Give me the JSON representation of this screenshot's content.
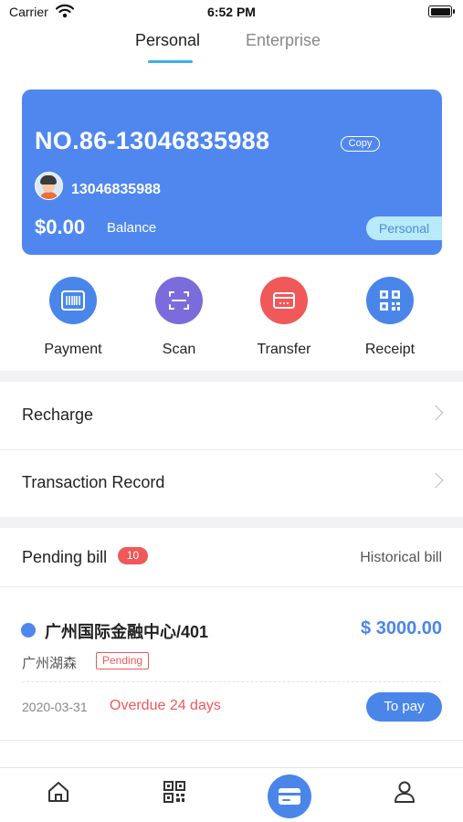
{
  "status_bar": {
    "carrier": "Carrier",
    "time": "6:52 PM"
  },
  "tabs": [
    {
      "label": "Personal",
      "active": true
    },
    {
      "label": "Enterprise",
      "active": false
    }
  ],
  "card": {
    "number": "NO.86-13046835988",
    "copy_label": "Copy",
    "phone": "13046835988",
    "balance_amount": "$0.00",
    "balance_label": "Balance",
    "type_tag": "Personal",
    "color": "#4f87ef"
  },
  "actions": [
    {
      "label": "Payment",
      "icon": "barcode-icon",
      "color": "#4a86ea"
    },
    {
      "label": "Scan",
      "icon": "scan-icon",
      "color": "#7b6cdc"
    },
    {
      "label": "Transfer",
      "icon": "card-icon",
      "color": "#f0585a"
    },
    {
      "label": "Receipt",
      "icon": "qr-code-icon",
      "color": "#4a86ea"
    }
  ],
  "menu": [
    {
      "label": "Recharge"
    },
    {
      "label": "Transaction Record"
    }
  ],
  "bills": {
    "pending_label": "Pending bill",
    "pending_count": "10",
    "historical_label": "Historical bill",
    "items": [
      {
        "title": "广州国际金融中心/401",
        "amount": "$ 3000.00",
        "subtitle": "广州湖森",
        "status": "Pending",
        "date": "2020-03-31",
        "overdue": "Overdue 24 days",
        "action_label": "To pay"
      }
    ]
  },
  "tabbar": [
    {
      "icon": "home-icon"
    },
    {
      "icon": "qr-code-icon"
    },
    {
      "icon": "card-icon",
      "active": true
    },
    {
      "icon": "user-icon"
    }
  ],
  "colors": {
    "accent": "#4a86ea",
    "danger": "#f0585a",
    "tab_indicator": "#3cb0e6"
  }
}
